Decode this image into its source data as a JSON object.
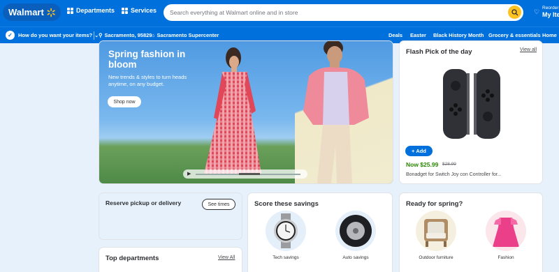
{
  "header": {
    "logo_text": "Walmart",
    "departments_label": "Departments",
    "services_label": "Services",
    "search_placeholder": "Search everything at Walmart online and in store",
    "reorder_line1": "Reorder",
    "reorder_line2": "My Items",
    "brand_color": "#0071dc",
    "accent_color": "#ffc220"
  },
  "subnav": {
    "want_items": "How do you want your items?",
    "location": "Sacramento, 95829",
    "store": "Sacramento Supercenter",
    "links": [
      "Deals",
      "Easter",
      "Black History Month",
      "Grocery & essentials",
      "Home"
    ]
  },
  "hero": {
    "title": "Spring fashion in bloom",
    "subtitle": "New trends & styles to turn heads anytime, on any budget.",
    "cta": "Shop now"
  },
  "flash_pick": {
    "title": "Flash Pick of the day",
    "view_all": "View all",
    "add_label": "Add",
    "price": "Now $25.99",
    "was_price": "$28.99",
    "product_name": "Bonadget for Switch Joy con Controller for..."
  },
  "pickup": {
    "title": "Reserve pickup or delivery",
    "button": "See times"
  },
  "top_departments": {
    "title": "Top departments",
    "view_all": "View All"
  },
  "savings": {
    "title": "Score these savings",
    "items": [
      {
        "label": "Tech savings",
        "icon": "watch-icon"
      },
      {
        "label": "Auto savings",
        "icon": "tire-icon"
      }
    ]
  },
  "spring": {
    "title": "Ready for spring?",
    "items": [
      {
        "label": "Outdoor furniture",
        "icon": "chair-icon"
      },
      {
        "label": "Fashion",
        "icon": "dress-icon"
      }
    ]
  }
}
